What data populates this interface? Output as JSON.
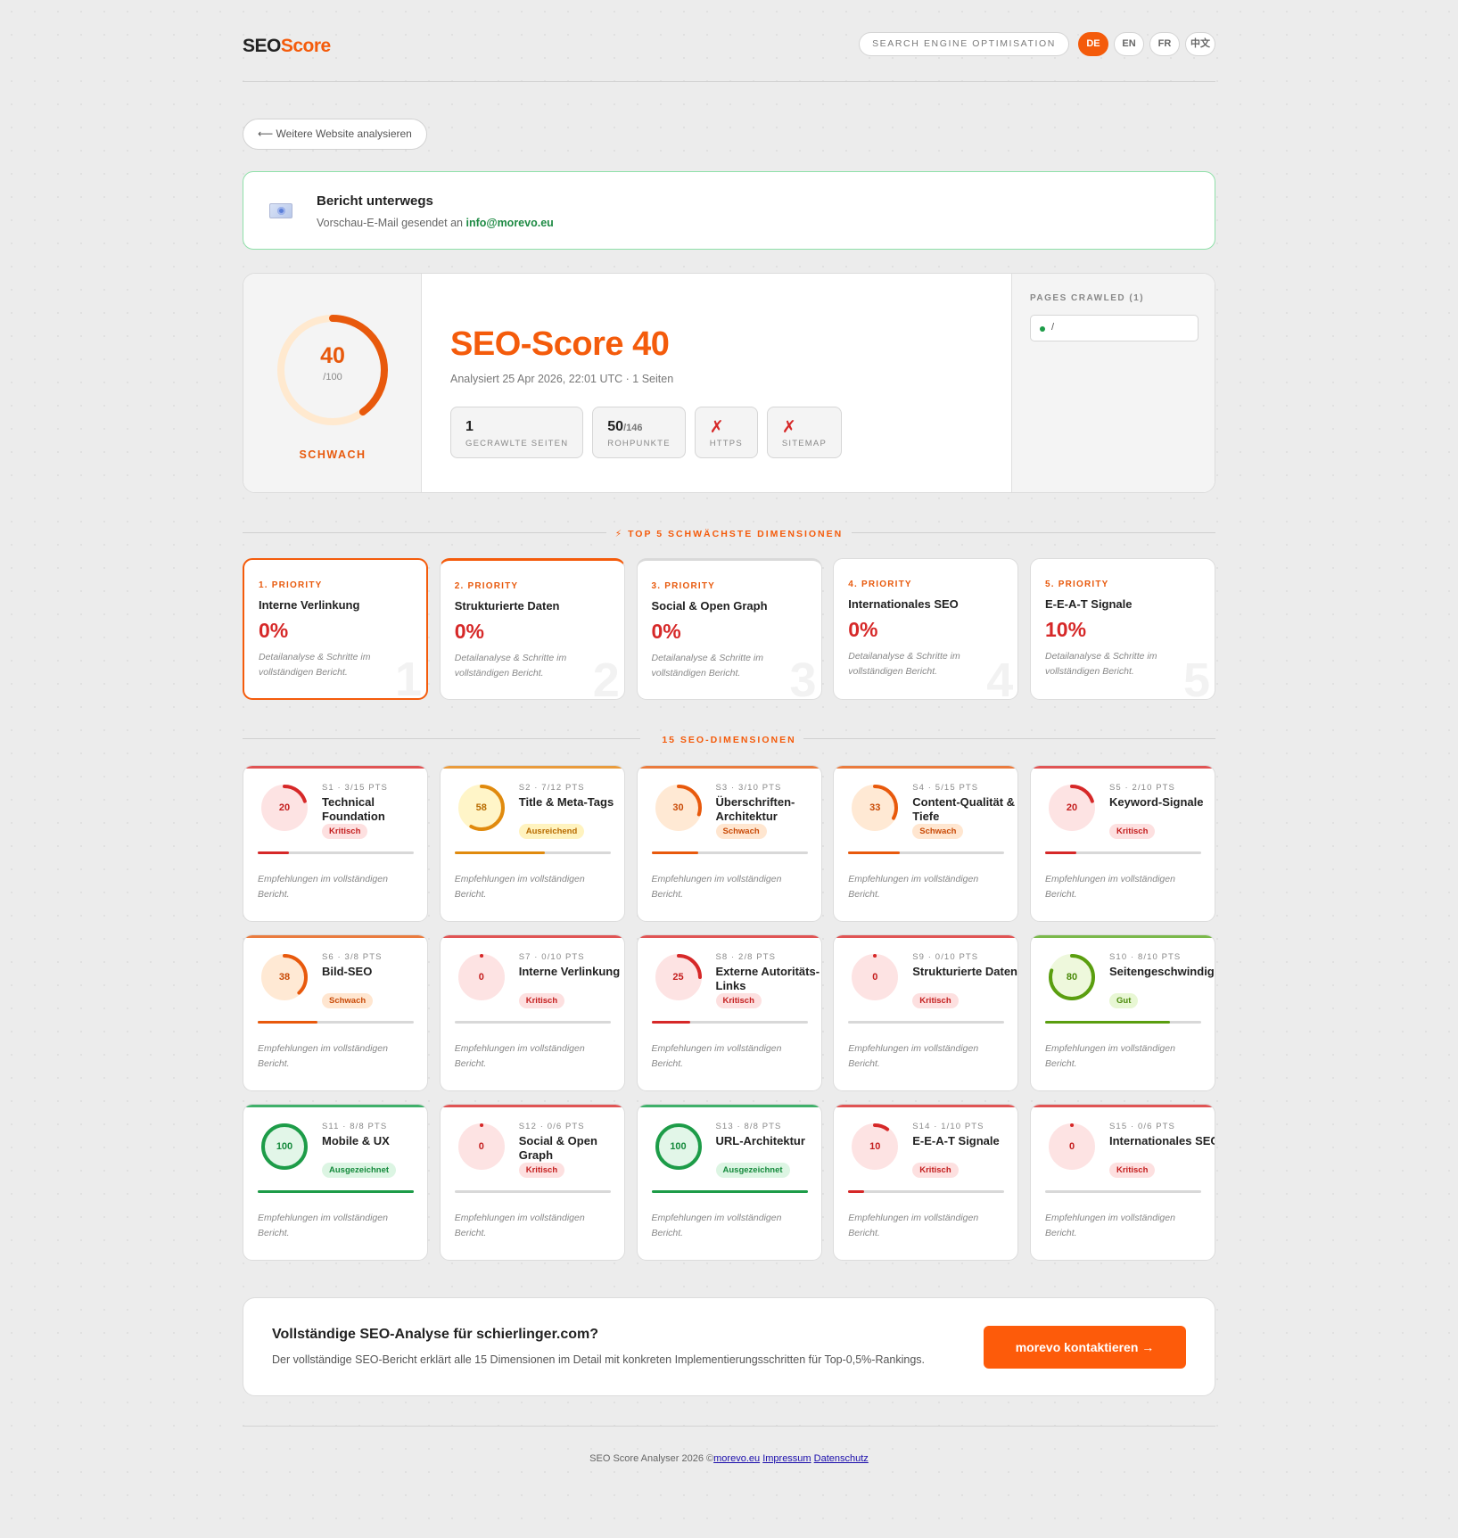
{
  "header": {
    "logo_a": "SEO",
    "logo_b": "Score",
    "search_pill": "SEARCH ENGINE OPTIMISATION",
    "languages": [
      "DE",
      "EN",
      "FR",
      "中文"
    ],
    "active_language": "DE"
  },
  "back_button": "⟵ Weitere Website analysieren",
  "notice": {
    "icon": "mail-icon",
    "title": "Bericht unterwegs",
    "text": "Vorschau-E-Mail gesendet an",
    "email": "info@morevo.eu"
  },
  "score": {
    "value": "40",
    "denominator": "/100",
    "value_fraction": 0.4,
    "grade": "SCHWACH",
    "title": "SEO-Score 40",
    "subtitle": "Analysiert 25 Apr 2026, 22:01 UTC · 1 Seiten",
    "stats": [
      {
        "value": "1",
        "suffix": "",
        "label": "GECRAWLTE SEITEN",
        "cross": false
      },
      {
        "value": "50",
        "suffix": "/146",
        "label": "ROHPUNKTE",
        "cross": false
      },
      {
        "value": "✗",
        "suffix": "",
        "label": "HTTPS",
        "cross": true
      },
      {
        "value": "✗",
        "suffix": "",
        "label": "SITEMAP",
        "cross": true
      }
    ],
    "pages_crawled_title": "PAGES CRAWLED (1)",
    "pages": [
      "/"
    ]
  },
  "top5": {
    "title": "⚡ TOP 5 SCHWÄCHSTE DIMENSIONEN",
    "items": [
      {
        "priority": "1. PRIORITY",
        "name": "Interne Verlinkung",
        "pct": "0%",
        "desc": "Detailanalyse & Schritte im vollständigen Bericht.",
        "big": "1"
      },
      {
        "priority": "2. PRIORITY",
        "name": "Strukturierte Daten",
        "pct": "0%",
        "desc": "Detailanalyse & Schritte im vollständigen Bericht.",
        "big": "2"
      },
      {
        "priority": "3. PRIORITY",
        "name": "Social & Open Graph",
        "pct": "0%",
        "desc": "Detailanalyse & Schritte im vollständigen Bericht.",
        "big": "3"
      },
      {
        "priority": "4. PRIORITY",
        "name": "Internationales SEO",
        "pct": "0%",
        "desc": "Detailanalyse & Schritte im vollständigen Bericht.",
        "big": "4"
      },
      {
        "priority": "5. PRIORITY",
        "name": "E-E-A-T Signale",
        "pct": "10%",
        "desc": "Detailanalyse & Schritte im vollständigen Bericht.",
        "big": "5"
      }
    ]
  },
  "dimensions": {
    "title": "15 SEO-DIMENSIONEN",
    "desc": "Empfehlungen im vollständigen Bericht.",
    "items": [
      {
        "meta": "S1 · 3/15 PTS",
        "name": "Technical Foundation",
        "score": 20,
        "badge": "Kritisch",
        "status": "crit"
      },
      {
        "meta": "S2 · 7/12 PTS",
        "name": "Title & Meta-Tags",
        "score": 58,
        "badge": "Ausreichend",
        "status": "ok"
      },
      {
        "meta": "S3 · 3/10 PTS",
        "name": "Überschriften-Architektur",
        "score": 30,
        "badge": "Schwach",
        "status": "weak"
      },
      {
        "meta": "S4 · 5/15 PTS",
        "name": "Content-Qualität & Tiefe",
        "score": 33,
        "badge": "Schwach",
        "status": "weak"
      },
      {
        "meta": "S5 · 2/10 PTS",
        "name": "Keyword-Signale",
        "score": 20,
        "badge": "Kritisch",
        "status": "crit"
      },
      {
        "meta": "S6 · 3/8 PTS",
        "name": "Bild-SEO",
        "score": 38,
        "badge": "Schwach",
        "status": "weak"
      },
      {
        "meta": "S7 · 0/10 PTS",
        "name": "Interne Verlinkung",
        "score": 0,
        "badge": "Kritisch",
        "status": "crit"
      },
      {
        "meta": "S8 · 2/8 PTS",
        "name": "Externe Autoritäts-Links",
        "score": 25,
        "badge": "Kritisch",
        "status": "crit"
      },
      {
        "meta": "S9 · 0/10 PTS",
        "name": "Strukturierte Daten",
        "score": 0,
        "badge": "Kritisch",
        "status": "crit"
      },
      {
        "meta": "S10 · 8/10 PTS",
        "name": "Seitengeschwindigkeit",
        "score": 80,
        "badge": "Gut",
        "status": "good"
      },
      {
        "meta": "S11 · 8/8 PTS",
        "name": "Mobile & UX",
        "score": 100,
        "badge": "Ausgezeichnet",
        "status": "great"
      },
      {
        "meta": "S12 · 0/6 PTS",
        "name": "Social & Open Graph",
        "score": 0,
        "badge": "Kritisch",
        "status": "crit"
      },
      {
        "meta": "S13 · 8/8 PTS",
        "name": "URL-Architektur",
        "score": 100,
        "badge": "Ausgezeichnet",
        "status": "great"
      },
      {
        "meta": "S14 · 1/10 PTS",
        "name": "E-E-A-T Signale",
        "score": 10,
        "badge": "Kritisch",
        "status": "crit"
      },
      {
        "meta": "S15 · 0/6 PTS",
        "name": "Internationales SEO",
        "score": 0,
        "badge": "Kritisch",
        "status": "crit"
      }
    ]
  },
  "status_colors": {
    "crit": {
      "ring": "#d62828",
      "bg": "#fde3e3",
      "text": "#c41e1e",
      "badge_bg": "#fde0e0",
      "top": "#e05454"
    },
    "ok": {
      "ring": "#e08a0e",
      "bg": "#fff5c8",
      "text": "#b86b00",
      "badge_bg": "#fff3bf",
      "top": "#e99b3c"
    },
    "weak": {
      "ring": "#e8590c",
      "bg": "#ffe9d4",
      "text": "#c94b08",
      "badge_bg": "#ffe6d0",
      "top": "#ea7b3e"
    },
    "good": {
      "ring": "#5a9e0f",
      "bg": "#eef8dc",
      "text": "#4a8a0a",
      "badge_bg": "#e8f7d4",
      "top": "#7ab84a"
    },
    "great": {
      "ring": "#1d9c48",
      "bg": "#e2f6e8",
      "text": "#158a3c",
      "badge_bg": "#dcf5e3",
      "top": "#3fb06a"
    }
  },
  "cta": {
    "title": "Vollständige SEO-Analyse für schierlinger.com?",
    "text": "Der vollständige SEO-Bericht erklärt alle 15 Dimensionen im Detail mit konkreten Implementierungsschritten für Top-0,5%-Rankings.",
    "button": "morevo kontaktieren →"
  },
  "footer": {
    "text": "SEO Score Analyser  2026 ©",
    "link1": "morevo.eu",
    "link2": "Impressum",
    "link3": "Datenschutz"
  }
}
